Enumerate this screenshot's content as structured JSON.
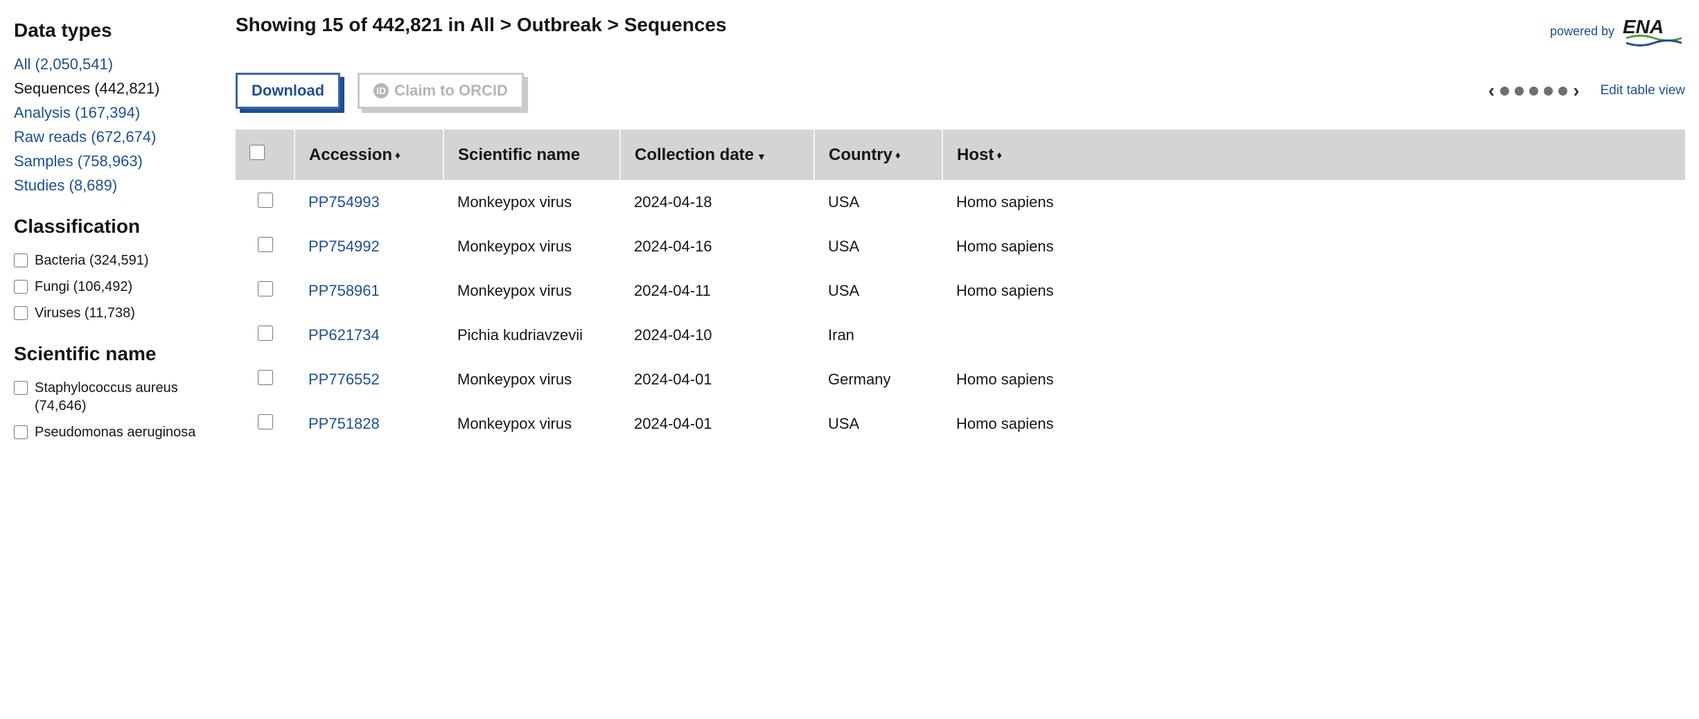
{
  "sidebar": {
    "data_types_title": "Data types",
    "data_types": [
      {
        "label": "All (2,050,541)",
        "active": false
      },
      {
        "label": "Sequences (442,821)",
        "active": true
      },
      {
        "label": "Analysis (167,394)",
        "active": false
      },
      {
        "label": "Raw reads (672,674)",
        "active": false
      },
      {
        "label": "Samples (758,963)",
        "active": false
      },
      {
        "label": "Studies (8,689)",
        "active": false
      }
    ],
    "classification_title": "Classification",
    "classification": [
      {
        "label": "Bacteria (324,591)"
      },
      {
        "label": "Fungi (106,492)"
      },
      {
        "label": "Viruses (11,738)"
      }
    ],
    "scientific_name_title": "Scientific name",
    "scientific_names": [
      {
        "label": "Staphylococcus aureus (74,646)"
      },
      {
        "label": "Pseudomonas aeruginosa"
      }
    ]
  },
  "header": {
    "heading": "Showing 15 of 442,821 in All > Outbreak > Sequences",
    "powered_by": "powered by",
    "logo_text": "ENA"
  },
  "toolbar": {
    "download_label": "Download",
    "orcid_label": "Claim to ORCID",
    "edit_table_label": "Edit table view"
  },
  "table": {
    "columns": {
      "accession": "Accession",
      "scientific_name": "Scientific name",
      "collection_date": "Collection date",
      "country": "Country",
      "host": "Host"
    },
    "rows": [
      {
        "accession": "PP754993",
        "scientific_name": "Monkeypox virus",
        "collection_date": "2024-04-18",
        "country": "USA",
        "host": "Homo sapiens"
      },
      {
        "accession": "PP754992",
        "scientific_name": "Monkeypox virus",
        "collection_date": "2024-04-16",
        "country": "USA",
        "host": "Homo sapiens"
      },
      {
        "accession": "PP758961",
        "scientific_name": "Monkeypox virus",
        "collection_date": "2024-04-11",
        "country": "USA",
        "host": "Homo sapiens"
      },
      {
        "accession": "PP621734",
        "scientific_name": "Pichia kudriavzevii",
        "collection_date": "2024-04-10",
        "country": "Iran",
        "host": ""
      },
      {
        "accession": "PP776552",
        "scientific_name": "Monkeypox virus",
        "collection_date": "2024-04-01",
        "country": "Germany",
        "host": "Homo sapiens"
      },
      {
        "accession": "PP751828",
        "scientific_name": "Monkeypox virus",
        "collection_date": "2024-04-01",
        "country": "USA",
        "host": "Homo sapiens"
      }
    ]
  }
}
